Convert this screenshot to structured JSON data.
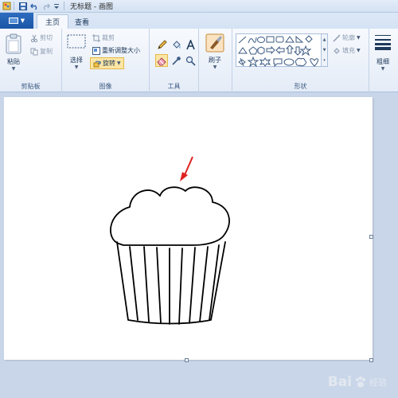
{
  "window": {
    "title": "无标题 - 画图"
  },
  "tabs": [
    {
      "label": "主页",
      "active": true
    },
    {
      "label": "查看",
      "active": false
    }
  ],
  "clipboard": {
    "paste_label": "粘贴",
    "cut_label": "剪切",
    "copy_label": "复制",
    "group_label": "剪贴板"
  },
  "image": {
    "select_label": "选择",
    "crop_label": "裁剪",
    "resize_label": "重新调整大小",
    "rotate_label": "旋转",
    "group_label": "图像"
  },
  "tools": {
    "group_label": "工具",
    "items": [
      "pencil-icon",
      "fill-icon",
      "text-icon",
      "eraser-icon",
      "color-picker-icon",
      "magnifier-icon"
    ]
  },
  "brushes": {
    "label": "刷子"
  },
  "shapes": {
    "group_label": "形状",
    "outline_label": "轮廓",
    "fill_label": "填充"
  },
  "size": {
    "label": "粗细"
  },
  "watermark": {
    "brand": "Bai",
    "sub": "经验"
  },
  "colors": {
    "accent": "#1b56a6",
    "annotation_arrow": "#e02020",
    "canvas": "#ffffff",
    "workspace": "#c9d6e9"
  }
}
